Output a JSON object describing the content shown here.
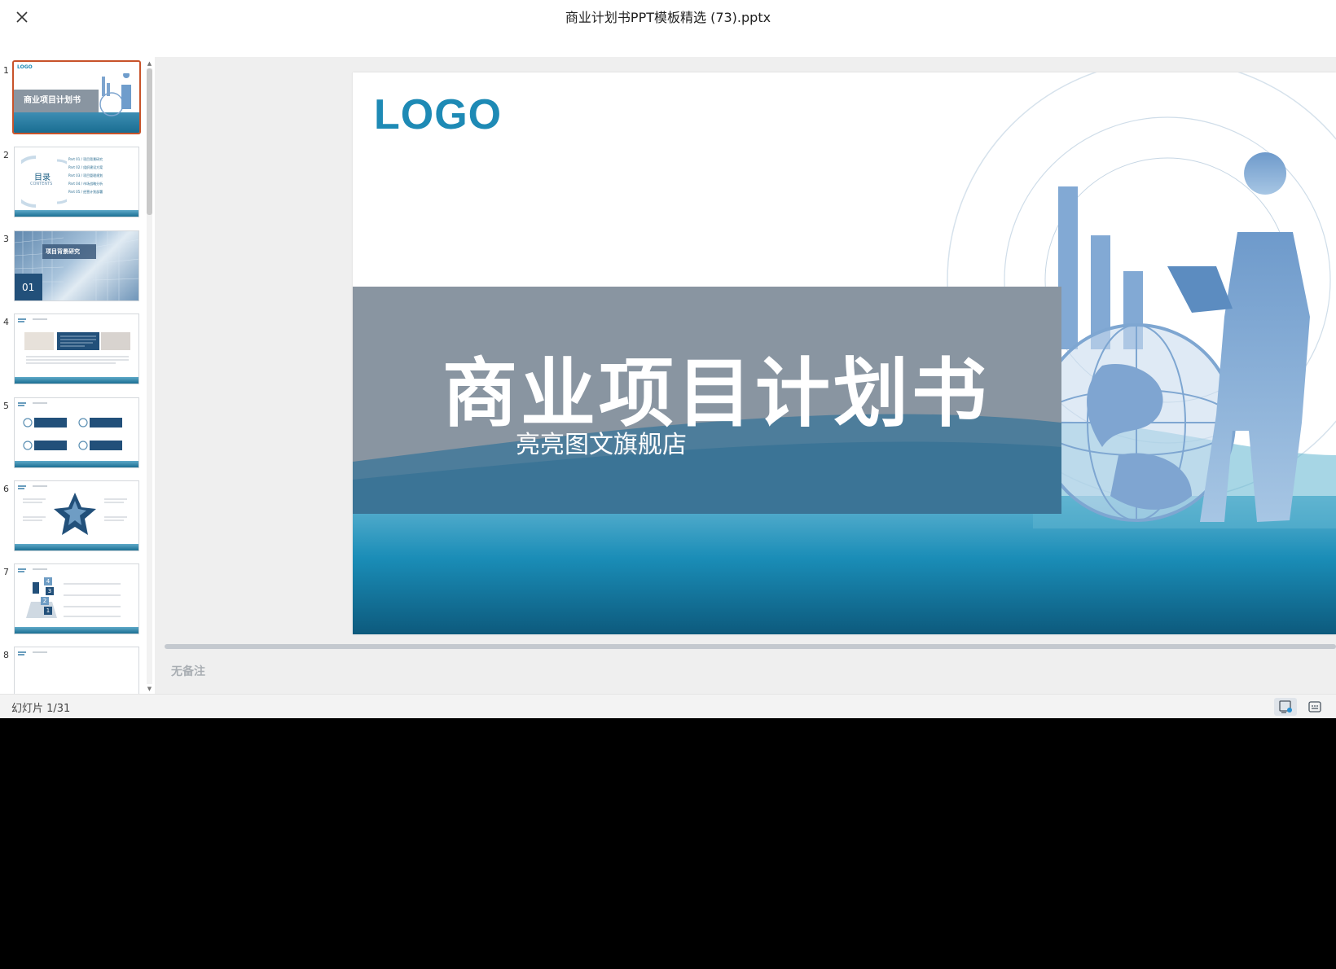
{
  "window": {
    "title": "商业计划书PPT模板精选 (73).pptx"
  },
  "thumbnails": [
    {
      "number": "1",
      "label": "商业项目计划书",
      "logo": "LOGO"
    },
    {
      "number": "2",
      "label": "目录",
      "sub": "CONTENTS",
      "items": [
        "Part 01 / 项目背景研究",
        "Part 02 / 组织建设方案",
        "Part 03 / 项目管理规划",
        "Part 04 / 市场战略分析",
        "Part 05 / 经营计划部署"
      ]
    },
    {
      "number": "3",
      "label": "项目背景研究",
      "badge": "01"
    },
    {
      "number": "4"
    },
    {
      "number": "5"
    },
    {
      "number": "6"
    },
    {
      "number": "7",
      "steps": [
        "4",
        "3",
        "2",
        "1"
      ]
    },
    {
      "number": "8"
    }
  ],
  "slide": {
    "logo": "LOGO",
    "title": "商业项目计划书",
    "subtitle": "亮亮图文旗舰店"
  },
  "notes": {
    "placeholder": "无备注"
  },
  "status": {
    "slide_counter": "幻灯片 1/31"
  },
  "colors": {
    "accent": "#1e8ab5",
    "active_border": "#c8532a",
    "band": "#8995a1"
  }
}
